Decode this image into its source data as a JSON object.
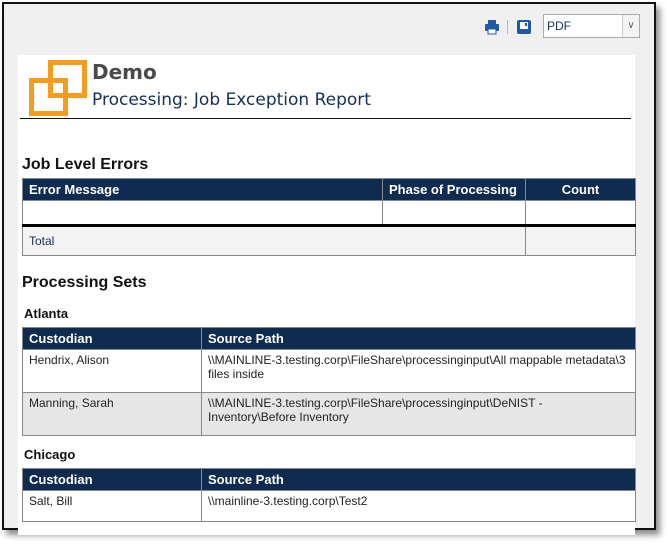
{
  "toolbar": {
    "print_icon": "print-icon",
    "save_icon": "save-icon",
    "export_format": "PDF"
  },
  "header": {
    "company": "Demo",
    "title": "Processing: Job Exception Report"
  },
  "job_errors": {
    "heading": "Job Level Errors",
    "columns": [
      "Error Message",
      "Phase of Processing",
      "Count"
    ],
    "rows": [
      [
        "",
        "",
        ""
      ]
    ],
    "total_label": "Total",
    "total_value": ""
  },
  "processing_sets": {
    "heading": "Processing Sets",
    "sets": [
      {
        "name": "Atlanta",
        "columns": [
          "Custodian",
          "Source Path"
        ],
        "rows": [
          [
            "Hendrix, Alison",
            "\\\\MAINLINE-3.testing.corp\\FileShare\\processinginput\\All mappable metadata\\3 files inside"
          ],
          [
            "Manning, Sarah",
            "\\\\MAINLINE-3.testing.corp\\FileShare\\processinginput\\DeNIST - Inventory\\Before Inventory"
          ]
        ]
      },
      {
        "name": "Chicago",
        "columns": [
          "Custodian",
          "Source Path"
        ],
        "rows": [
          [
            "Salt, Bill",
            "\\\\mainline-3.testing.corp\\Test2"
          ]
        ]
      }
    ]
  },
  "colors": {
    "accent": "#f39c20",
    "header_bg": "#0f2c50"
  }
}
